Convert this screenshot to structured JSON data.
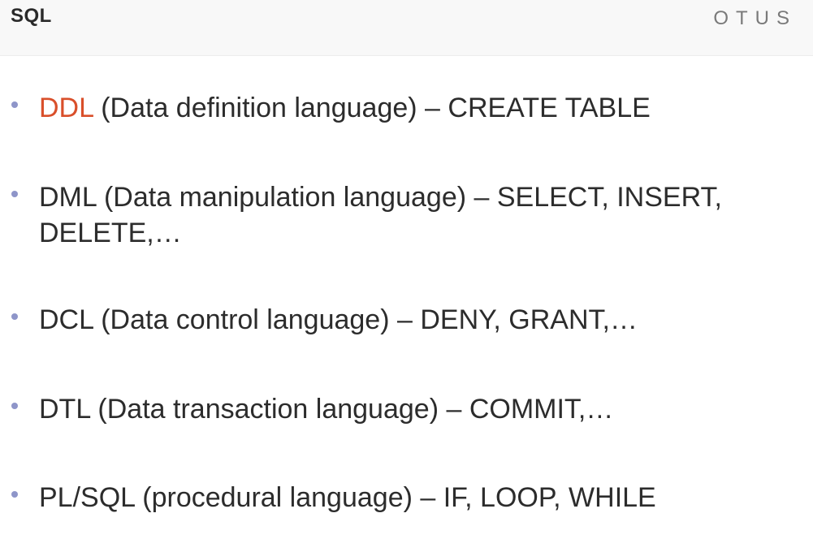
{
  "header": {
    "title": "SQL",
    "logo_text": "OTUS"
  },
  "bullets": [
    {
      "term": "DDL",
      "rest": " (Data definition language) – CREATE TABLE"
    },
    {
      "term": "DML",
      "rest": " (Data manipulation language) – SELECT, INSERT, DELETE,…"
    },
    {
      "term": "DCL",
      "rest": " (Data control language) – DENY, GRANT,…"
    },
    {
      "term": "DTL",
      "rest": " (Data transaction language) – COMMIT,…"
    },
    {
      "term": "PL/SQL",
      "rest": " (procedural language) – IF, LOOP, WHILE"
    }
  ],
  "colors": {
    "highlight": "#d94f2a",
    "bullet": "#8e95c9",
    "text": "#2c2c2c"
  }
}
